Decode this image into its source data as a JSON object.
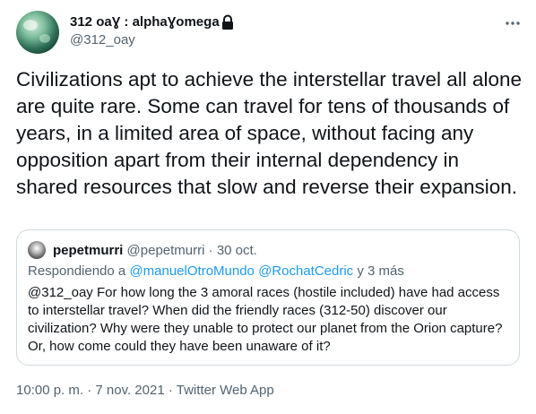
{
  "author": {
    "display_name": "312 oaƔ : alphaƔomega",
    "handle": "@312_oay",
    "avatar_icon": "planet-avatar",
    "verified_icon": "lock-icon"
  },
  "menu_icon": "more-horizontal-icon",
  "tweet": {
    "text": "Civilizations apt to achieve the interstellar travel all alone are quite rare. Some can travel for tens of thousands of years, in a limited area of space, without facing any opposition apart from their internal dependency in shared resources that slow and reverse their expansion."
  },
  "quoted": {
    "name": "pepetmurri",
    "handle": "@pepetmurri",
    "separator": "·",
    "date": "30 oct.",
    "reply_prefix": "Respondiendo a",
    "reply_users": [
      "@manuelOtroMundo",
      "@RochatCedric"
    ],
    "reply_suffix": "y 3 más",
    "text": "@312_oay For how long the 3 amoral races (hostile included) have had access to interstellar travel? When did the friendly races (312-50) discover our civilization? Why were they unable to protect our planet from the Orion capture? Or, how come could they have been unaware of it?"
  },
  "footer": {
    "time": "10:00 p. m.",
    "date": "7 nov. 2021",
    "source": "Twitter Web App",
    "separator": "·"
  },
  "colors": {
    "text": "#0f1419",
    "secondary": "#536471",
    "link": "#1d9bf0",
    "border": "#cfd9de"
  }
}
